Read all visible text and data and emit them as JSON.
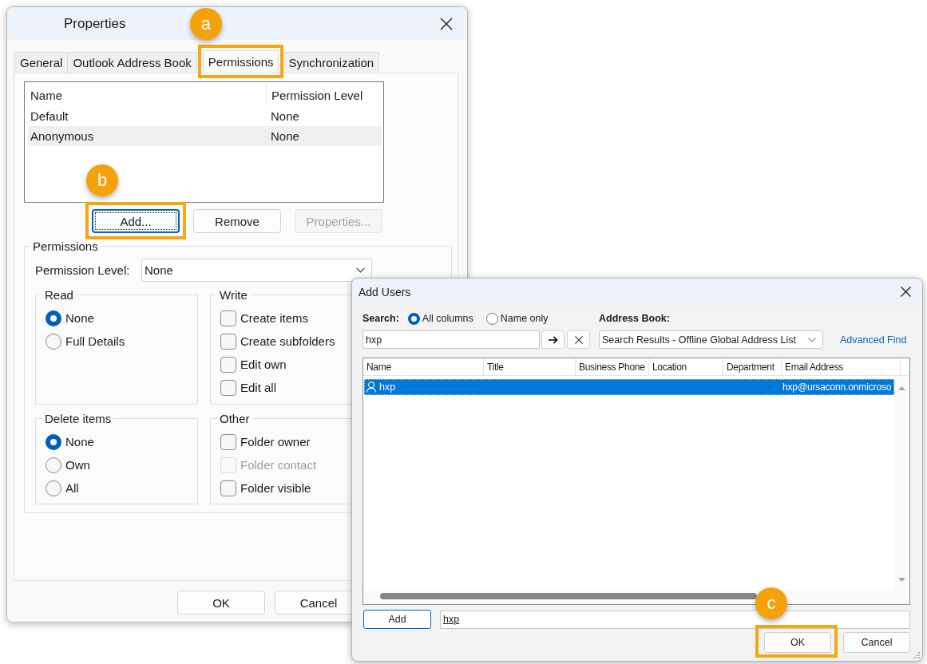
{
  "properties_dialog": {
    "title": "Properties",
    "tabs": [
      {
        "label": "General",
        "selected": false
      },
      {
        "label": "Outlook Address Book",
        "selected": false
      },
      {
        "label": "Permissions",
        "selected": true,
        "callout": "a"
      },
      {
        "label": "Synchronization",
        "selected": false
      }
    ],
    "permission_table": {
      "columns": [
        "Name",
        "Permission Level"
      ],
      "rows": [
        {
          "name": "Default",
          "permission_level": "None",
          "selected": false
        },
        {
          "name": "Anonymous",
          "permission_level": "None",
          "selected": true
        }
      ]
    },
    "table_buttons": [
      {
        "label": "Add...",
        "focused": true,
        "disabled": false,
        "callout": "b"
      },
      {
        "label": "Remove",
        "focused": false,
        "disabled": false
      },
      {
        "label": "Properties...",
        "focused": false,
        "disabled": true
      }
    ],
    "permissions": {
      "title": "Permissions",
      "level_label": "Permission Level:",
      "level_value": "None",
      "groups": [
        {
          "title": "Read",
          "kind": "radio",
          "options": [
            {
              "label": "None",
              "selected": true
            },
            {
              "label": "Full Details",
              "selected": false
            }
          ]
        },
        {
          "title": "Write",
          "kind": "checkbox",
          "options": [
            {
              "label": "Create items",
              "checked": false,
              "disabled": false
            },
            {
              "label": "Create subfolders",
              "checked": false,
              "disabled": false
            },
            {
              "label": "Edit own",
              "checked": false,
              "disabled": false
            },
            {
              "label": "Edit all",
              "checked": false,
              "disabled": false
            }
          ]
        },
        {
          "title": "Delete items",
          "kind": "radio",
          "options": [
            {
              "label": "None",
              "selected": true
            },
            {
              "label": "Own",
              "selected": false
            },
            {
              "label": "All",
              "selected": false
            }
          ]
        },
        {
          "title": "Other",
          "kind": "checkbox",
          "options": [
            {
              "label": "Folder owner",
              "checked": false,
              "disabled": false
            },
            {
              "label": "Folder contact",
              "checked": false,
              "disabled": true
            },
            {
              "label": "Folder visible",
              "checked": false,
              "disabled": false
            }
          ]
        }
      ]
    },
    "buttons": [
      {
        "label": "OK"
      },
      {
        "label": "Cancel"
      }
    ]
  },
  "add_users_dialog": {
    "title": "Add Users",
    "search_label": "Search:",
    "search_scope": [
      {
        "label": "All columns",
        "selected": true
      },
      {
        "label": "Name only",
        "selected": false
      }
    ],
    "address_book_label": "Address Book:",
    "search_field": {
      "value": "hxp"
    },
    "address_book": {
      "value": "Search Results - Offline Global Address List"
    },
    "advanced_find": "Advanced Find",
    "results": {
      "columns": [
        "Name",
        "Title",
        "Business Phone",
        "Location",
        "Department",
        "Email Address"
      ],
      "rows": [
        {
          "name": "hxp",
          "email_address": "hxp@ursaconn.onmicroso",
          "selected": true
        }
      ]
    },
    "add_button": {
      "label": "Add",
      "focused": true
    },
    "recipients_field": {
      "value": "hxp",
      "resolved": true
    },
    "buttons": [
      {
        "label": "OK",
        "callout": "c"
      },
      {
        "label": "Cancel"
      }
    ]
  }
}
